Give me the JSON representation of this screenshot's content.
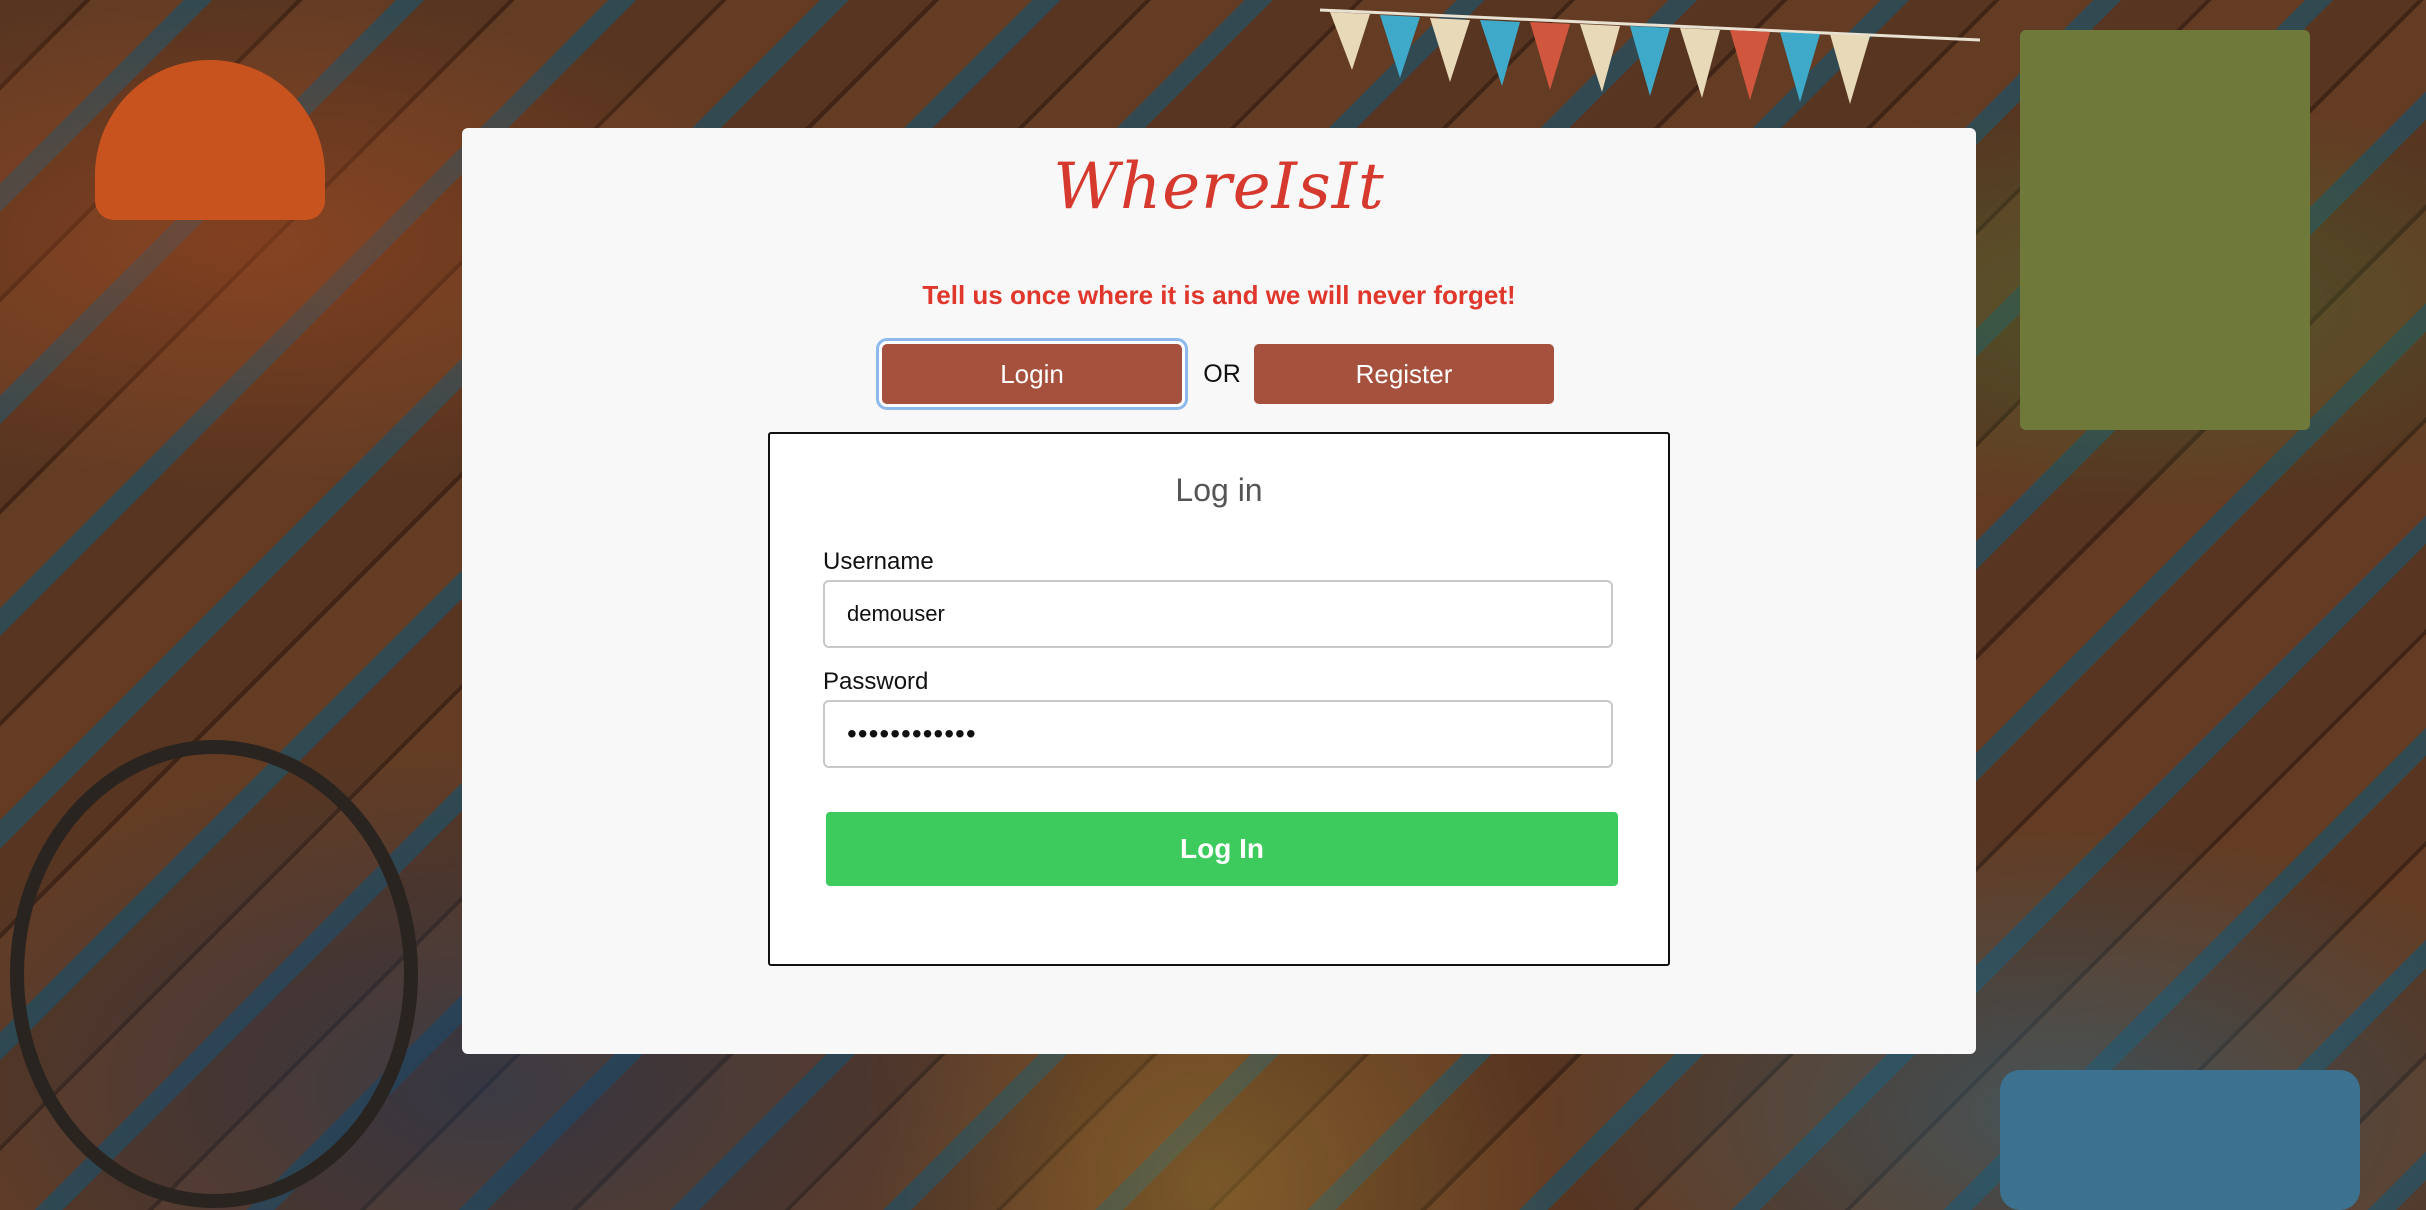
{
  "app": {
    "title": "WhereIsIt",
    "tagline": "Tell us once where it is and we will never forget!"
  },
  "tabs": {
    "login_label": "Login",
    "or_label": "OR",
    "register_label": "Register"
  },
  "login_form": {
    "heading": "Log in",
    "username_label": "Username",
    "username_value": "demouser",
    "password_label": "Password",
    "password_value": "••••••••••••",
    "submit_label": "Log In"
  },
  "colors": {
    "brand_red": "#d63a2f",
    "tab_button": "#a5513d",
    "submit_green": "#3dcb5e",
    "focus_ring": "#8db9ec"
  }
}
